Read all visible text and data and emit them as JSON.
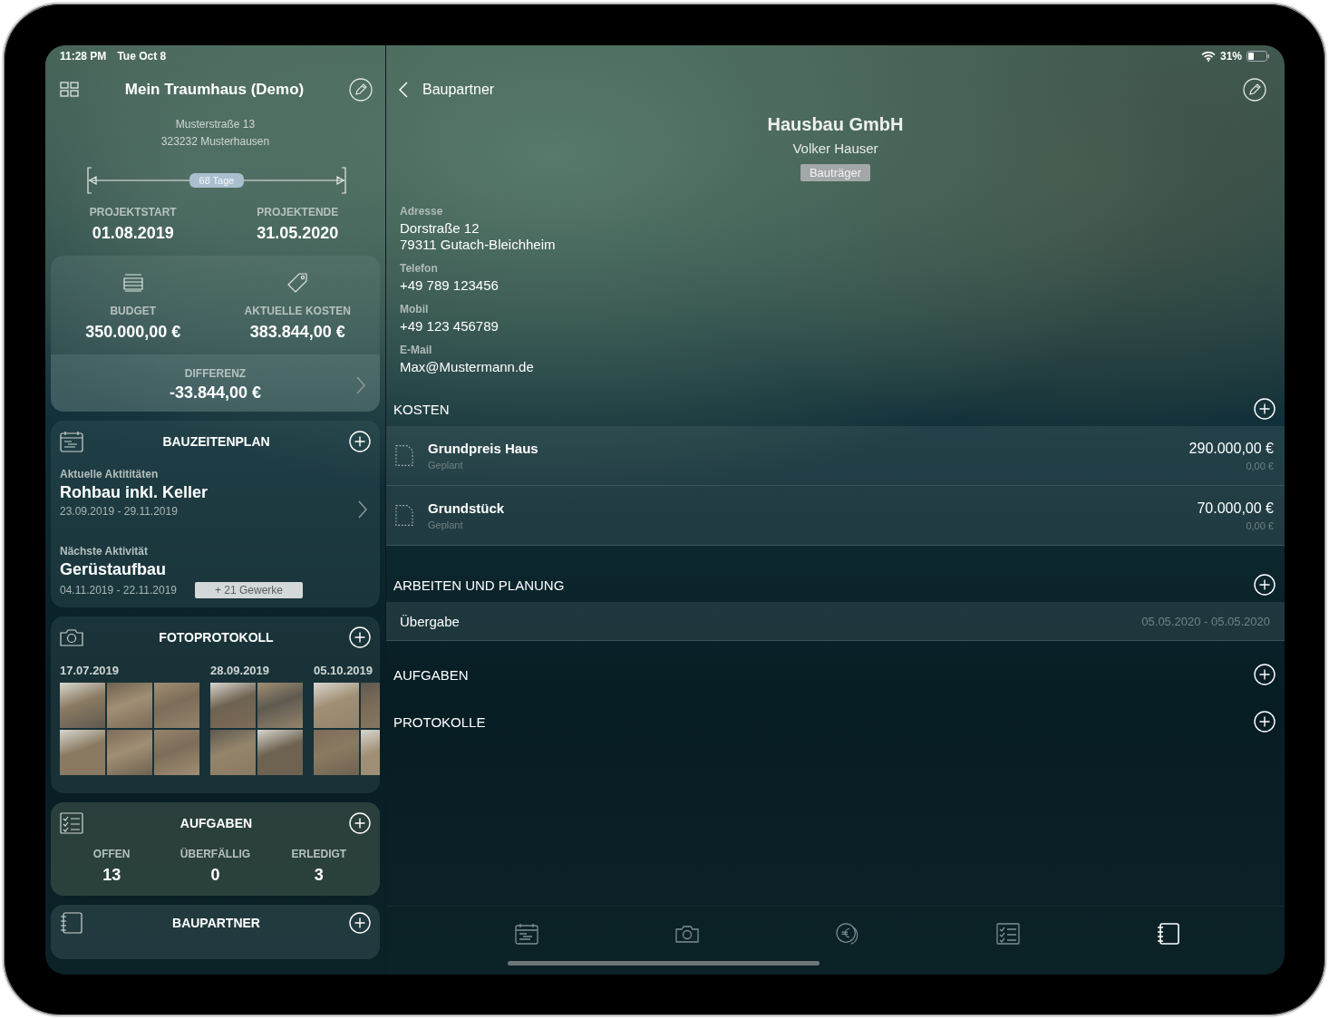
{
  "status_bar": {
    "time": "11:28 PM",
    "date": "Tue Oct 8",
    "battery": "31%"
  },
  "sidebar": {
    "title": "Mein Traumhaus (Demo)",
    "address": [
      "Musterstraße 13",
      "323232 Musterhausen"
    ],
    "duration_label": "68 Tage",
    "dates": [
      {
        "label": "PROJEKTSTART",
        "value": "01.08.2019"
      },
      {
        "label": "PROJEKTENDE",
        "value": "31.05.2020"
      }
    ],
    "budget": {
      "items": [
        {
          "kind": "budget",
          "label": "BUDGET",
          "value": "350.000,00 €"
        },
        {
          "kind": "costs",
          "label": "AKTUELLE KOSTEN",
          "value": "383.844,00 €"
        }
      ],
      "difference": {
        "label": "DIFFERENZ",
        "value": "-33.844,00 €"
      }
    },
    "schedule": {
      "title": "BAUZEITENPLAN",
      "current": {
        "label": "Aktuelle Aktititäten",
        "name": "Rohbau inkl. Keller",
        "dates": "23.09.2019 - 29.11.2019"
      },
      "next": {
        "label": "Nächste Aktivität",
        "name": "Gerüstaufbau",
        "dates": "04.11.2019 - 22.11.2019",
        "badge": "+ 21 Gewerke"
      }
    },
    "photos": {
      "title": "FOTOPROTOKOLL",
      "groups": [
        {
          "date": "17.07.2019"
        },
        {
          "date": "28.09.2019"
        },
        {
          "date": "05.10.2019"
        }
      ]
    },
    "tasks": {
      "title": "AUFGABEN",
      "counts": [
        {
          "label": "OFFEN",
          "value": "13"
        },
        {
          "label": "ÜBERFÄLLIG",
          "value": "0"
        },
        {
          "label": "ERLEDIGT",
          "value": "3"
        }
      ]
    },
    "partners": {
      "title": "BAUPARTNER"
    }
  },
  "detail": {
    "back_label": "Baupartner",
    "company": "Hausbau GmbH",
    "contact": "Volker Hauser",
    "tag": "Bauträger",
    "fields": [
      {
        "label": "Adresse",
        "lines": [
          "Dorstraße 12",
          "79311 Gutach-Bleichheim"
        ]
      },
      {
        "label": "Telefon",
        "lines": [
          "+49 789 123456"
        ]
      },
      {
        "label": "Mobil",
        "lines": [
          "+49 123 456789"
        ]
      },
      {
        "label": "E-Mail",
        "lines": [
          "Max@Mustermann.de"
        ]
      }
    ],
    "sections": [
      {
        "kind": "costs",
        "title": "KOSTEN",
        "rows": [
          {
            "name": "Grundpreis Haus",
            "status": "Geplant",
            "amount": "290.000,00 €",
            "paid": "0,00 €"
          },
          {
            "name": "Grundstück",
            "status": "Geplant",
            "amount": "70.000,00 €",
            "paid": "0,00 €"
          }
        ]
      },
      {
        "kind": "work",
        "title": "ARBEITEN UND PLANUNG",
        "rows": [
          {
            "name": "Übergabe",
            "dates": "05.05.2020 - 05.05.2020"
          }
        ]
      },
      {
        "kind": "plain",
        "title": "AUFGABEN"
      },
      {
        "kind": "plain",
        "title": "PROTOKOLLE"
      }
    ]
  },
  "tab_bar": [
    {
      "kind": "schedule",
      "selected": false
    },
    {
      "kind": "photos",
      "selected": false
    },
    {
      "kind": "costs",
      "selected": false
    },
    {
      "kind": "tasks",
      "selected": false
    },
    {
      "kind": "partners",
      "selected": true
    }
  ]
}
